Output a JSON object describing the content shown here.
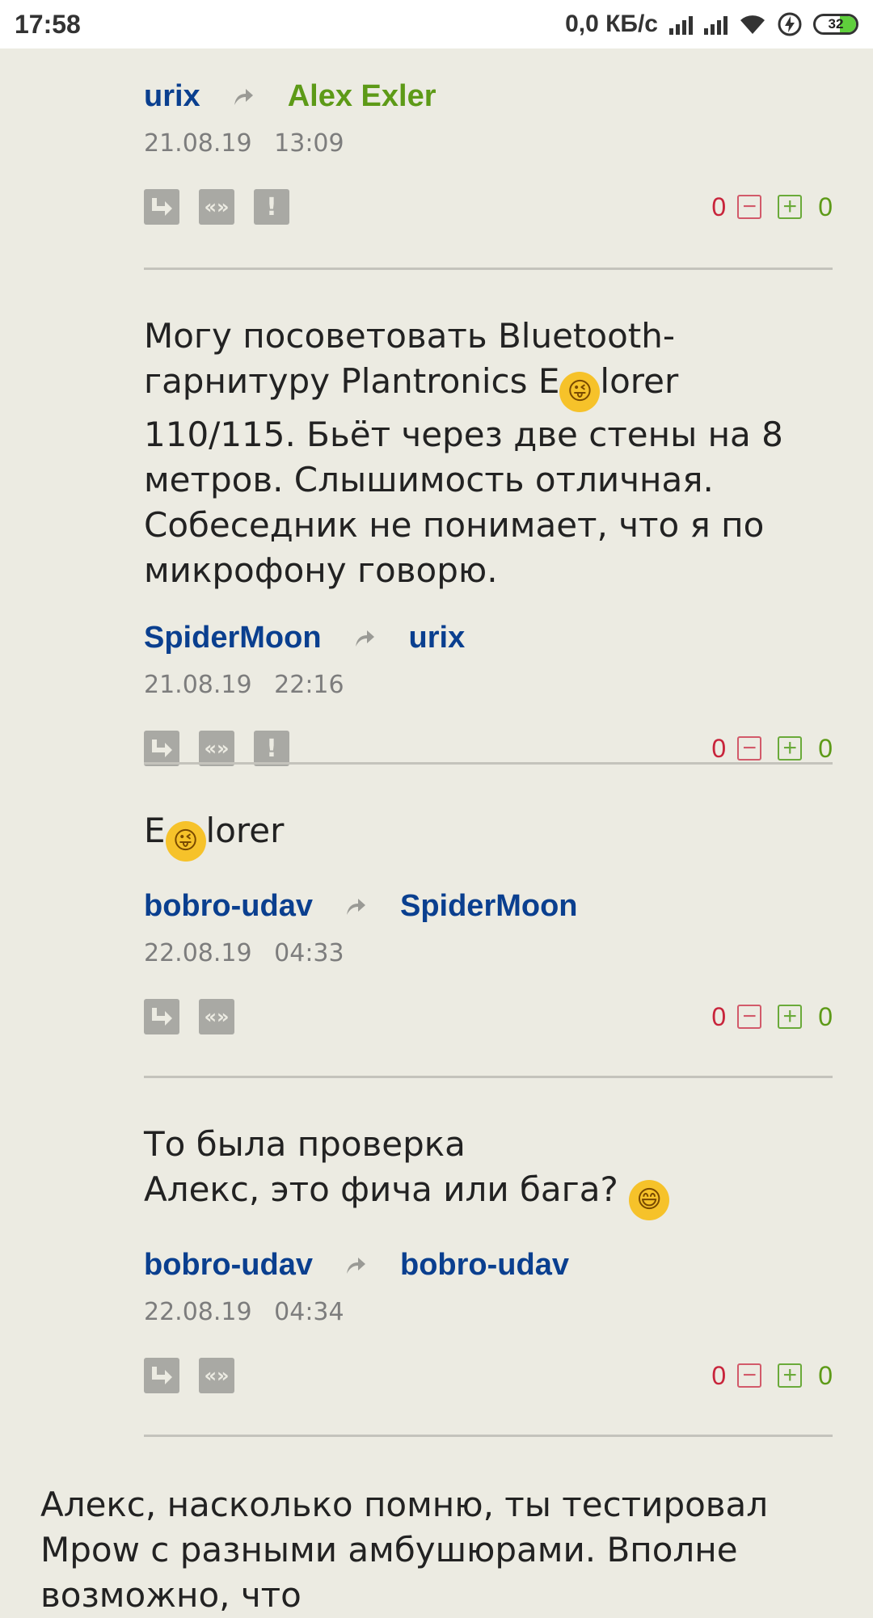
{
  "status_bar": {
    "time": "17:58",
    "speed": "0,0 КБ/с",
    "battery_level": "32",
    "icons": [
      "signal-icon",
      "signal-icon",
      "wifi-icon",
      "charging-icon",
      "battery-icon"
    ]
  },
  "comments": [
    {
      "text": "",
      "author": "urix",
      "reply_to": "Alex Exler",
      "date": "21.08.19",
      "time": "13:09",
      "votes_minus": "0",
      "votes_plus": "0"
    },
    {
      "text_before_emoji": "Могу посоветовать Bluetooth-гарнитуру Plantronics E",
      "text_after_emoji": "lorer 110/115. Бьёт через две стены на 8 метров. Слышимость отличная. Собеседник не понимает, что я по микрофону говорю.",
      "author": "SpiderMoon",
      "reply_to": "urix",
      "date": "21.08.19",
      "time": "22:16",
      "votes_minus": "0",
      "votes_plus": "0"
    },
    {
      "text_before_emoji": "E",
      "text_after_emoji": "lorer",
      "author": "bobro-udav",
      "reply_to": "SpiderMoon",
      "date": "22.08.19",
      "time": "04:33",
      "votes_minus": "0",
      "votes_plus": "0"
    },
    {
      "line1": "То была проверка",
      "line2": "Алекс, это фича или бага?",
      "author": "bobro-udav",
      "reply_to": "bobro-udav",
      "date": "22.08.19",
      "time": "04:34",
      "votes_minus": "0",
      "votes_plus": "0"
    }
  ],
  "next_comment_text": "Алекс, насколько помню, ты тестировал Mpow с разными амбушюрами. Вполне возможно, что",
  "colors": {
    "author": "#0a3f8f",
    "author_highlight": "#5d9a17",
    "minus": "#c8243b",
    "plus": "#5d9a17",
    "background": "#ecebe2"
  }
}
